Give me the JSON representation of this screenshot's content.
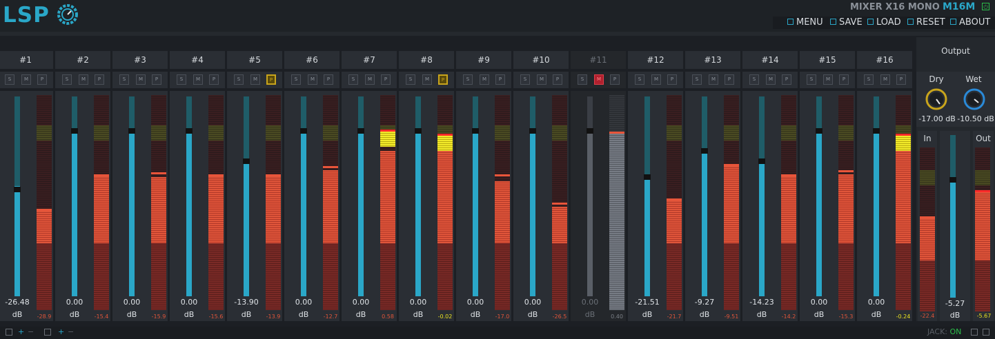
{
  "header": {
    "logo": "LSP",
    "plugin_name": "MIXER X16 MONO",
    "plugin_code": "M16M",
    "menu": [
      {
        "label": "MENU",
        "icon": "menu-icon"
      },
      {
        "label": "SAVE",
        "icon": "save-icon"
      },
      {
        "label": "LOAD",
        "icon": "load-icon"
      },
      {
        "label": "RESET",
        "icon": "reset-icon"
      },
      {
        "label": "ABOUT",
        "icon": "about-icon"
      }
    ]
  },
  "channels": [
    {
      "name": "#1",
      "gain": "-26.48",
      "unit": "dB",
      "meter": "-28.9",
      "fader": 0.55,
      "level": 0.47,
      "peak": 0.47,
      "solo": false,
      "mute": false,
      "phase": false,
      "enabled": true
    },
    {
      "name": "#2",
      "gain": "0.00",
      "unit": "dB",
      "meter": "-15.4",
      "fader": 0.84,
      "level": 0.63,
      "peak": 0.63,
      "solo": false,
      "mute": false,
      "phase": false,
      "enabled": true
    },
    {
      "name": "#3",
      "gain": "0.00",
      "unit": "dB",
      "meter": "-15.9",
      "fader": 0.84,
      "level": 0.62,
      "peak": 0.64,
      "solo": false,
      "mute": false,
      "phase": false,
      "enabled": true
    },
    {
      "name": "#4",
      "gain": "0.00",
      "unit": "dB",
      "meter": "-15.6",
      "fader": 0.84,
      "level": 0.63,
      "peak": 0.63,
      "solo": false,
      "mute": false,
      "phase": false,
      "enabled": true
    },
    {
      "name": "#5",
      "gain": "-13.90",
      "unit": "dB",
      "meter": "-13.9",
      "fader": 0.69,
      "level": 0.63,
      "peak": 0.63,
      "solo": false,
      "mute": false,
      "phase": true,
      "enabled": true
    },
    {
      "name": "#6",
      "gain": "0.00",
      "unit": "dB",
      "meter": "-12.7",
      "fader": 0.84,
      "level": 0.65,
      "peak": 0.67,
      "solo": false,
      "mute": false,
      "phase": false,
      "enabled": true
    },
    {
      "name": "#7",
      "gain": "0.00",
      "unit": "dB",
      "meter": "0.58",
      "fader": 0.84,
      "level": 0.74,
      "peak": 0.84,
      "solo": false,
      "mute": false,
      "phase": false,
      "enabled": true,
      "hot": 0.08
    },
    {
      "name": "#8",
      "gain": "0.00",
      "unit": "dB",
      "meter": "-0.02",
      "fader": 0.84,
      "level": 0.74,
      "peak": 0.82,
      "solo": false,
      "mute": false,
      "phase": true,
      "enabled": true,
      "hot": 0.08
    },
    {
      "name": "#9",
      "gain": "0.00",
      "unit": "dB",
      "meter": "-17.0",
      "fader": 0.84,
      "level": 0.6,
      "peak": 0.63,
      "solo": false,
      "mute": false,
      "phase": false,
      "enabled": true
    },
    {
      "name": "#10",
      "gain": "0.00",
      "unit": "dB",
      "meter": "-26.5",
      "fader": 0.84,
      "level": 0.48,
      "peak": 0.5,
      "solo": false,
      "mute": false,
      "phase": false,
      "enabled": true
    },
    {
      "name": "#11",
      "gain": "0.00",
      "unit": "dB",
      "meter": "0.40",
      "fader": 0.84,
      "level": 0.83,
      "peak": 0.83,
      "solo": false,
      "mute": true,
      "phase": false,
      "enabled": false
    },
    {
      "name": "#12",
      "gain": "-21.51",
      "unit": "dB",
      "meter": "-21.7",
      "fader": 0.61,
      "level": 0.52,
      "peak": 0.52,
      "solo": false,
      "mute": false,
      "phase": false,
      "enabled": true
    },
    {
      "name": "#13",
      "gain": "-9.27",
      "unit": "dB",
      "meter": "-9.51",
      "fader": 0.74,
      "level": 0.68,
      "peak": 0.68,
      "solo": false,
      "mute": false,
      "phase": false,
      "enabled": true
    },
    {
      "name": "#14",
      "gain": "-14.23",
      "unit": "dB",
      "meter": "-14.2",
      "fader": 0.69,
      "level": 0.63,
      "peak": 0.63,
      "solo": false,
      "mute": false,
      "phase": false,
      "enabled": true
    },
    {
      "name": "#15",
      "gain": "0.00",
      "unit": "dB",
      "meter": "-15.3",
      "fader": 0.84,
      "level": 0.63,
      "peak": 0.65,
      "solo": false,
      "mute": false,
      "phase": false,
      "enabled": true
    },
    {
      "name": "#16",
      "gain": "0.00",
      "unit": "dB",
      "meter": "-0.24",
      "fader": 0.84,
      "level": 0.74,
      "peak": 0.82,
      "solo": false,
      "mute": false,
      "phase": false,
      "enabled": true,
      "hot": 0.08
    }
  ],
  "buttons": {
    "solo": "S",
    "mute": "M",
    "phase": "P"
  },
  "output": {
    "title": "Output",
    "dry_label": "Dry",
    "dry_value": "-17.00 dB",
    "wet_label": "Wet",
    "wet_value": "-10.50 dB",
    "in_label": "In",
    "in_meter": "-22.4",
    "out_label": "Out",
    "out_meter": "-5.67",
    "gain": "-5.27",
    "unit": "dB",
    "in_level": 0.58,
    "out_level": 0.74,
    "fader": 0.74
  },
  "statusbar": {
    "jack_label": "JACK:",
    "jack_state": "ON",
    "zoom_plus": "+",
    "zoom_minus": "−"
  },
  "colors": {
    "accent": "#2aa7c8",
    "meter": "#e0553a",
    "hot": "#f2ea2a",
    "on": "#2cbd4a"
  }
}
